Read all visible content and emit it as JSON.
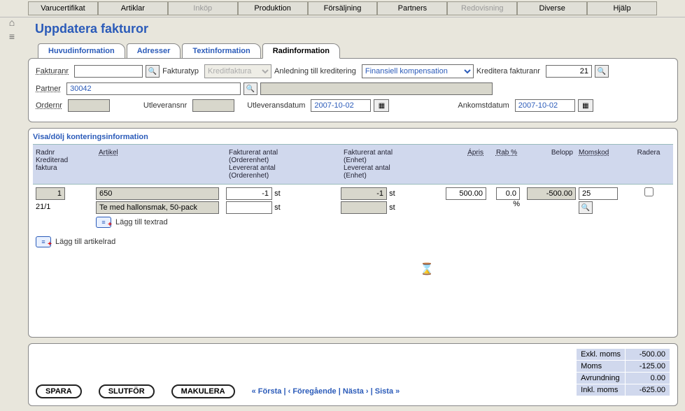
{
  "top_menu": {
    "varucertifikat": "Varucertifikat",
    "artiklar": "Artiklar",
    "inkop": "Inköp",
    "produktion": "Produktion",
    "forsaljning": "Försäljning",
    "partners": "Partners",
    "redovisning": "Redovisning",
    "diverse": "Diverse",
    "hjalp": "Hjälp"
  },
  "page_title": "Uppdatera fakturor",
  "tabs": {
    "huvudinformation": "Huvudinformation",
    "adresser": "Adresser",
    "textinformation": "Textinformation",
    "radinformation": "Radinformation"
  },
  "header_form": {
    "fakturanr_label": "Fakturanr",
    "fakturanr": "",
    "fakturatyp_label": "Fakturatyp",
    "fakturatyp": "Kreditfaktura",
    "anledning_label": "Anledning till kreditering",
    "anledning": "Finansiell kompensation",
    "kreditera_label": "Kreditera fakturanr",
    "kreditera_val": "21",
    "partner_label": "Partner",
    "partner_val": "30042",
    "partner_desc": "",
    "ordernr_label": "Ordernr",
    "ordernr_val": "",
    "utleveransnr_label": "Utleveransnr",
    "utleveransnr_val": "",
    "utleveransdatum_label": "Utleveransdatum",
    "utleveransdatum_val": "2007-10-02",
    "ankomstdatum_label": "Ankomstdatum",
    "ankomstdatum_val": "2007-10-02"
  },
  "grid": {
    "section_title": "Visa/dölj konteringsinformation",
    "headers": {
      "radnr": "Radnr\nKrediterad\nfaktura",
      "artikel": "Artikel",
      "fakt1": "Fakturerat antal\n(Orderenhet)\nLevererat antal\n(Orderenhet)",
      "fakt2": "Fakturerat antal\n(Enhet)\nLevererat antal\n(Enhet)",
      "apris": "Ápris",
      "rab": "Rab %",
      "belopp": "Belopp",
      "momskod": "Momskod",
      "radera": "Radera"
    },
    "row": {
      "radnr": "1",
      "radnr_sub": "21/1",
      "artikel_kod": "650",
      "artikel_namn": "Te med hallonsmak, 50-pack",
      "fakt1_a": "-1",
      "fakt1_b": "",
      "fakt2_a": "-1",
      "fakt2_b": "",
      "unit1": "st",
      "unit2": "st",
      "apris": "500.00",
      "rab": "0.0",
      "rab_suffix": "%",
      "belopp": "-500.00",
      "momskod": "25"
    },
    "add_textrad": "Lägg till textrad",
    "add_artikelrad": "Lägg till artikelrad"
  },
  "totals": {
    "exkl_l": "Exkl. moms",
    "exkl_v": "-500.00",
    "moms_l": "Moms",
    "moms_v": "-125.00",
    "avr_l": "Avrundning",
    "avr_v": "0.00",
    "inkl_l": "Inkl. moms",
    "inkl_v": "-625.00"
  },
  "actions": {
    "spara": "SPARA",
    "slutfor": "SLUTFÖR",
    "makulera": "MAKULERA"
  },
  "pager": {
    "forsta": "« Första",
    "foregaende": "‹ Föregående",
    "nasta": "Nästa ›",
    "sista": "Sista »",
    "sep": " | "
  }
}
